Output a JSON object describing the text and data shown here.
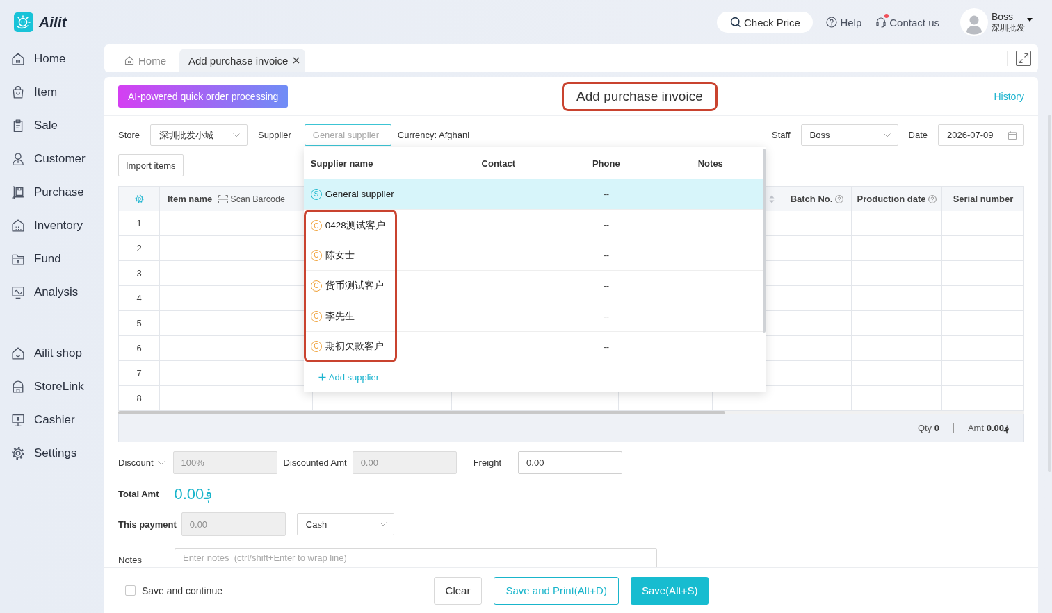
{
  "app": {
    "name": "Ailit"
  },
  "top_bar": {
    "check_price": "Check Price",
    "help": "Help",
    "contact": {
      "label": "Contact us",
      "unread": true
    },
    "user": {
      "name": "Boss",
      "company": "深圳批发"
    }
  },
  "sidebar": {
    "groups": [
      {
        "items": [
          {
            "label": "Home",
            "selected": false
          },
          {
            "label": "Item",
            "selected": false
          },
          {
            "label": "Sale",
            "selected": false
          },
          {
            "label": "Customer",
            "selected": false
          },
          {
            "label": "Purchase",
            "selected": false
          },
          {
            "label": "Inventory",
            "selected": false
          },
          {
            "label": "Fund",
            "selected": false
          },
          {
            "label": "Analysis",
            "selected": false
          }
        ]
      },
      {
        "items": [
          {
            "label": "Ailit shop",
            "selected": false
          },
          {
            "label": "StoreLink",
            "selected": false
          },
          {
            "label": "Cashier",
            "selected": false
          },
          {
            "label": "Settings",
            "selected": false
          }
        ]
      }
    ]
  },
  "tabs": [
    {
      "label": "Home",
      "kind": "home",
      "selected": false
    },
    {
      "label": "Add purchase invoice",
      "kind": "page",
      "selected": true
    }
  ],
  "header": {
    "ai_button": "AI-powered quick order processing",
    "title": {
      "text": "Add purchase invoice",
      "highlighted": true
    },
    "history": "History"
  },
  "form": {
    "store": {
      "label": "Store",
      "value": "深圳批发小城"
    },
    "supplier": {
      "label": "Supplier",
      "placeholder": "General supplier",
      "focused": true
    },
    "currency": "Currency: Afghani",
    "staff": {
      "label": "Staff",
      "value": "Boss"
    },
    "date": {
      "label": "Date",
      "value": "2026-07-09"
    },
    "import_button": "Import items"
  },
  "supplier_dropdown": {
    "columns": [
      "Supplier name",
      "Contact",
      "Phone",
      "Notes"
    ],
    "groups": [
      {
        "highlighted": false,
        "rows": [
          {
            "tag": "S",
            "color": "#1bb8cc",
            "name": "General supplier",
            "phone": "--",
            "selected": true
          }
        ]
      },
      {
        "highlighted": true,
        "rows": [
          {
            "tag": "C",
            "color": "#f0a23a",
            "name": "0428测试客户",
            "phone": "--",
            "selected": false
          },
          {
            "tag": "C",
            "color": "#f0a23a",
            "name": "陈女士",
            "phone": "--",
            "selected": false
          },
          {
            "tag": "C",
            "color": "#f0a23a",
            "name": "货币测试客户",
            "phone": "--",
            "selected": false
          },
          {
            "tag": "C",
            "color": "#f0a23a",
            "name": "李先生",
            "phone": "--",
            "selected": false
          },
          {
            "tag": "C",
            "color": "#f0a23a",
            "name": "期初欠款客户",
            "phone": "--",
            "selected": false
          }
        ]
      }
    ],
    "add_label": "Add supplier"
  },
  "table": {
    "columns": [
      {
        "kind": "settings"
      },
      {
        "kind": "item",
        "label": "Item name",
        "scan_label": "Scan Barcode"
      },
      {
        "kind": "blank"
      },
      {
        "kind": "blank"
      },
      {
        "kind": "blank"
      },
      {
        "kind": "blank"
      },
      {
        "kind": "blank"
      },
      {
        "kind": "sortable"
      },
      {
        "kind": "help",
        "label": "Batch No."
      },
      {
        "kind": "help",
        "label": "Production date"
      },
      {
        "kind": "plain",
        "label": "Serial number"
      }
    ],
    "rows": [
      "1",
      "2",
      "3",
      "4",
      "5",
      "6",
      "7",
      "8"
    ]
  },
  "summary": {
    "qty": "Qty **0**",
    "amount": "Amt **0.00؋**"
  },
  "payment": {
    "discount": {
      "label": "Discount",
      "placeholder": "100%",
      "disabled": true
    },
    "discounted_amt": {
      "label": "Discounted Amt",
      "placeholder": "0.00",
      "disabled": true
    },
    "freight": {
      "label": "Freight",
      "value": "0.00",
      "disabled": false
    },
    "total": {
      "label": "Total Amt",
      "value": "0.00؋"
    },
    "this_payment": {
      "label": "This payment",
      "placeholder": "0.00",
      "disabled": true,
      "method": "Cash"
    },
    "notes": {
      "label": "Notes",
      "placeholder": "Enter notes  (ctrl/shift+Enter to wrap line)"
    }
  },
  "footer": {
    "save_continue": {
      "label": "Save and continue",
      "checked": false
    },
    "buttons": [
      {
        "label": "Clear",
        "kind": "default"
      },
      {
        "label": "Save and Print(Alt+D)",
        "kind": "outline"
      },
      {
        "label": "Save(Alt+S)",
        "kind": "primary"
      }
    ]
  }
}
